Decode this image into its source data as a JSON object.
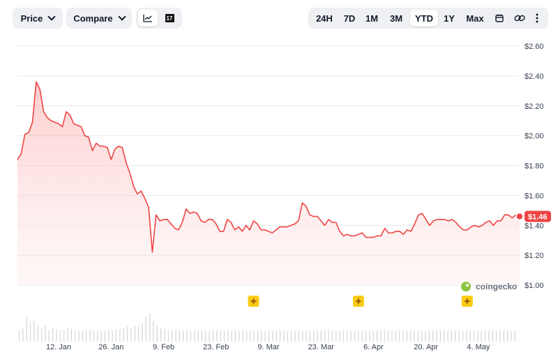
{
  "toolbar": {
    "price_label": "Price",
    "compare_label": "Compare",
    "chart_type_line_icon": "line-chart-icon",
    "chart_type_tv_icon": "tradingview-icon",
    "tv_icon_text": "17",
    "ranges": [
      "24H",
      "7D",
      "1M",
      "3M",
      "YTD",
      "1Y",
      "Max"
    ],
    "active_range": "YTD",
    "calendar_icon": "calendar-icon",
    "link_icon": "link-icon",
    "more_icon": "more-vertical-icon"
  },
  "colors": {
    "line": "#ef4444",
    "area_top": "#fca5a5",
    "badge": "#ef4444",
    "event_marker": "#facc15",
    "logo": "#8dc63f"
  },
  "current_price_badge": "$1.46",
  "watermark": "coingecko",
  "chart_data": {
    "type": "area",
    "title": "",
    "xlabel": "",
    "ylabel": "",
    "ylim": [
      1.0,
      2.6
    ],
    "xlim": [
      "2025-01-01",
      "2025-05-15"
    ],
    "y_ticks": [
      2.6,
      2.4,
      2.2,
      2.0,
      1.8,
      1.6,
      1.4,
      1.2,
      1.0
    ],
    "y_tick_labels": [
      "$2.60",
      "$2.40",
      "$2.20",
      "$2.00",
      "$1.80",
      "$1.60",
      "$1.40",
      "$1.20",
      "$1.00"
    ],
    "x_ticks": [
      "2025-01-12",
      "2025-01-26",
      "2025-02-09",
      "2025-02-23",
      "2025-03-09",
      "2025-03-23",
      "2025-04-06",
      "2025-04-20",
      "2025-05-04"
    ],
    "x_tick_labels": [
      "12. Jan",
      "26. Jan",
      "9. Feb",
      "23. Feb",
      "9. Mar",
      "23. Mar",
      "6. Apr",
      "20. Apr",
      "4. May"
    ],
    "grid": true,
    "series": [
      {
        "points": [
          [
            "2025-01-01",
            1.84
          ],
          [
            "2025-01-02",
            1.88
          ],
          [
            "2025-01-03",
            2.01
          ],
          [
            "2025-01-04",
            2.02
          ],
          [
            "2025-01-05",
            2.09
          ],
          [
            "2025-01-06",
            2.36
          ],
          [
            "2025-01-07",
            2.31
          ],
          [
            "2025-01-08",
            2.16
          ],
          [
            "2025-01-09",
            2.12
          ],
          [
            "2025-01-10",
            2.1
          ],
          [
            "2025-01-11",
            2.09
          ],
          [
            "2025-01-12",
            2.08
          ],
          [
            "2025-01-13",
            2.06
          ],
          [
            "2025-01-14",
            2.16
          ],
          [
            "2025-01-15",
            2.14
          ],
          [
            "2025-01-16",
            2.08
          ],
          [
            "2025-01-17",
            2.07
          ],
          [
            "2025-01-18",
            2.06
          ],
          [
            "2025-01-19",
            2.0
          ],
          [
            "2025-01-20",
            1.99
          ],
          [
            "2025-01-21",
            1.9
          ],
          [
            "2025-01-22",
            1.95
          ],
          [
            "2025-01-23",
            1.93
          ],
          [
            "2025-01-24",
            1.93
          ],
          [
            "2025-01-25",
            1.92
          ],
          [
            "2025-01-26",
            1.84
          ],
          [
            "2025-01-27",
            1.91
          ],
          [
            "2025-01-28",
            1.93
          ],
          [
            "2025-01-29",
            1.92
          ],
          [
            "2025-01-30",
            1.82
          ],
          [
            "2025-01-31",
            1.75
          ],
          [
            "2025-02-01",
            1.66
          ],
          [
            "2025-02-02",
            1.61
          ],
          [
            "2025-02-03",
            1.63
          ],
          [
            "2025-02-04",
            1.58
          ],
          [
            "2025-02-05",
            1.52
          ],
          [
            "2025-02-06",
            1.22
          ],
          [
            "2025-02-07",
            1.47
          ],
          [
            "2025-02-08",
            1.43
          ],
          [
            "2025-02-09",
            1.44
          ],
          [
            "2025-02-10",
            1.44
          ],
          [
            "2025-02-11",
            1.41
          ],
          [
            "2025-02-12",
            1.38
          ],
          [
            "2025-02-13",
            1.37
          ],
          [
            "2025-02-14",
            1.42
          ],
          [
            "2025-02-15",
            1.51
          ],
          [
            "2025-02-16",
            1.48
          ],
          [
            "2025-02-17",
            1.49
          ],
          [
            "2025-02-18",
            1.48
          ],
          [
            "2025-02-19",
            1.43
          ],
          [
            "2025-02-20",
            1.42
          ],
          [
            "2025-02-21",
            1.44
          ],
          [
            "2025-02-22",
            1.44
          ],
          [
            "2025-02-23",
            1.41
          ],
          [
            "2025-02-24",
            1.36
          ],
          [
            "2025-02-25",
            1.36
          ],
          [
            "2025-02-26",
            1.44
          ],
          [
            "2025-02-27",
            1.42
          ],
          [
            "2025-02-28",
            1.37
          ],
          [
            "2025-03-01",
            1.39
          ],
          [
            "2025-03-02",
            1.36
          ],
          [
            "2025-03-03",
            1.4
          ],
          [
            "2025-03-04",
            1.37
          ],
          [
            "2025-03-05",
            1.43
          ],
          [
            "2025-03-06",
            1.41
          ],
          [
            "2025-03-07",
            1.37
          ],
          [
            "2025-03-08",
            1.37
          ],
          [
            "2025-03-09",
            1.36
          ],
          [
            "2025-03-10",
            1.35
          ],
          [
            "2025-03-11",
            1.37
          ],
          [
            "2025-03-12",
            1.39
          ],
          [
            "2025-03-13",
            1.39
          ],
          [
            "2025-03-14",
            1.39
          ],
          [
            "2025-03-15",
            1.4
          ],
          [
            "2025-03-16",
            1.41
          ],
          [
            "2025-03-17",
            1.43
          ],
          [
            "2025-03-18",
            1.55
          ],
          [
            "2025-03-19",
            1.53
          ],
          [
            "2025-03-20",
            1.47
          ],
          [
            "2025-03-21",
            1.46
          ],
          [
            "2025-03-22",
            1.46
          ],
          [
            "2025-03-23",
            1.43
          ],
          [
            "2025-03-24",
            1.4
          ],
          [
            "2025-03-25",
            1.44
          ],
          [
            "2025-03-26",
            1.42
          ],
          [
            "2025-03-27",
            1.42
          ],
          [
            "2025-03-28",
            1.36
          ],
          [
            "2025-03-29",
            1.33
          ],
          [
            "2025-03-30",
            1.34
          ],
          [
            "2025-03-31",
            1.33
          ],
          [
            "2025-04-01",
            1.33
          ],
          [
            "2025-04-02",
            1.34
          ],
          [
            "2025-04-03",
            1.35
          ],
          [
            "2025-04-04",
            1.32
          ],
          [
            "2025-04-05",
            1.32
          ],
          [
            "2025-04-06",
            1.32
          ],
          [
            "2025-04-07",
            1.33
          ],
          [
            "2025-04-08",
            1.33
          ],
          [
            "2025-04-09",
            1.38
          ],
          [
            "2025-04-10",
            1.35
          ],
          [
            "2025-04-11",
            1.35
          ],
          [
            "2025-04-12",
            1.36
          ],
          [
            "2025-04-13",
            1.36
          ],
          [
            "2025-04-14",
            1.34
          ],
          [
            "2025-04-15",
            1.37
          ],
          [
            "2025-04-16",
            1.36
          ],
          [
            "2025-04-17",
            1.41
          ],
          [
            "2025-04-18",
            1.47
          ],
          [
            "2025-04-19",
            1.48
          ],
          [
            "2025-04-20",
            1.44
          ],
          [
            "2025-04-21",
            1.4
          ],
          [
            "2025-04-22",
            1.43
          ],
          [
            "2025-04-23",
            1.44
          ],
          [
            "2025-04-24",
            1.44
          ],
          [
            "2025-04-25",
            1.44
          ],
          [
            "2025-04-26",
            1.43
          ],
          [
            "2025-04-27",
            1.44
          ],
          [
            "2025-04-28",
            1.42
          ],
          [
            "2025-04-29",
            1.39
          ],
          [
            "2025-04-30",
            1.37
          ],
          [
            "2025-05-01",
            1.37
          ],
          [
            "2025-05-02",
            1.39
          ],
          [
            "2025-05-03",
            1.4
          ],
          [
            "2025-05-04",
            1.39
          ],
          [
            "2025-05-05",
            1.4
          ],
          [
            "2025-05-06",
            1.42
          ],
          [
            "2025-05-07",
            1.43
          ],
          [
            "2025-05-08",
            1.4
          ],
          [
            "2025-05-09",
            1.43
          ],
          [
            "2025-05-10",
            1.43
          ],
          [
            "2025-05-11",
            1.47
          ],
          [
            "2025-05-12",
            1.47
          ],
          [
            "2025-05-13",
            1.45
          ],
          [
            "2025-05-14",
            1.47
          ],
          [
            "2025-05-15",
            1.46
          ]
        ]
      }
    ],
    "last_value": 1.46,
    "event_markers": [
      "2025-03-05",
      "2025-04-02",
      "2025-05-01"
    ],
    "volume_bars": [
      0.3,
      0.4,
      0.9,
      0.6,
      0.7,
      0.5,
      0.4,
      0.5,
      0.3,
      0.4,
      0.35,
      0.3,
      0.3,
      0.4,
      0.35,
      0.3,
      0.3,
      0.3,
      0.3,
      0.35,
      0.3,
      0.3,
      0.3,
      0.3,
      0.3,
      0.3,
      0.35,
      0.35,
      0.4,
      0.45,
      0.4,
      0.5,
      0.5,
      0.6,
      0.9,
      1.0,
      0.7,
      0.5,
      0.4,
      0.35,
      0.3,
      0.3,
      0.3,
      0.3,
      0.3,
      0.3,
      0.3,
      0.3,
      0.3,
      0.3,
      0.3,
      0.3,
      0.3,
      0.3,
      0.3,
      0.3,
      0.3,
      0.3,
      0.3,
      0.3,
      0.3,
      0.3,
      0.3,
      0.3,
      0.3,
      0.3,
      0.3,
      0.3,
      0.3,
      0.3,
      0.3,
      0.3,
      0.3,
      0.3,
      0.3,
      0.3,
      0.3,
      0.3,
      0.3,
      0.3,
      0.3,
      0.3,
      0.3,
      0.3,
      0.3,
      0.3,
      0.3,
      0.3,
      0.3,
      0.3,
      0.3,
      0.3,
      0.3,
      0.3,
      0.3,
      0.3,
      0.3,
      0.3,
      0.3,
      0.3,
      0.3,
      0.3,
      0.3,
      0.3,
      0.3,
      0.3,
      0.3,
      0.3,
      0.3,
      0.3,
      0.3,
      0.3,
      0.3,
      0.3,
      0.3,
      0.3,
      0.3,
      0.3,
      0.3,
      0.3,
      0.3,
      0.3,
      0.3,
      0.3,
      0.3,
      0.3,
      0.3,
      0.3,
      0.3,
      0.3,
      0.3,
      0.3,
      0.3,
      0.3
    ]
  }
}
